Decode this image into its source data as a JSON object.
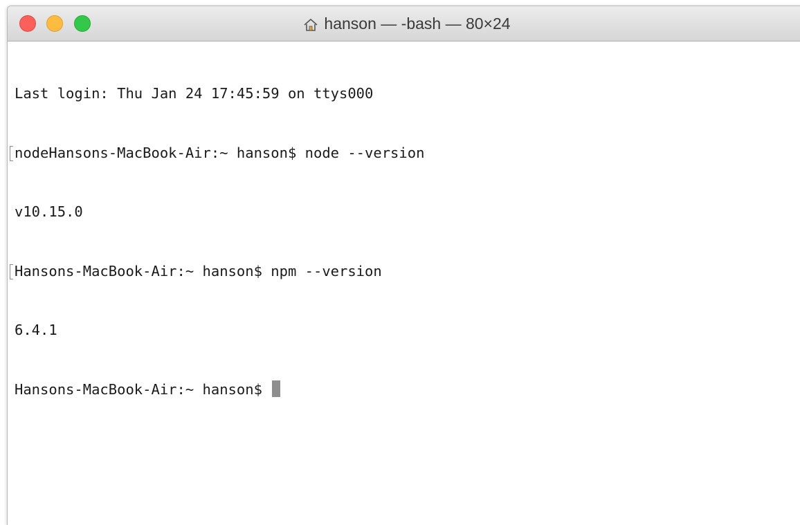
{
  "window": {
    "title": "hanson — -bash — 80×24",
    "title_icon": "home-icon",
    "traffic_lights": {
      "close_color": "#fc605b",
      "minimize_color": "#fdbc40",
      "zoom_color": "#34c84a"
    }
  },
  "terminal": {
    "lines": [
      {
        "text": "Last login: Thu Jan 24 17:45:59 on ttys000",
        "marked": false
      },
      {
        "text": "nodeHansons-MacBook-Air:~ hanson$ node --version",
        "marked": true
      },
      {
        "text": "v10.15.0",
        "marked": false
      },
      {
        "text": "Hansons-MacBook-Air:~ hanson$ npm --version",
        "marked": true
      },
      {
        "text": "6.4.1",
        "marked": false
      }
    ],
    "prompt": "Hansons-MacBook-Air:~ hanson$ "
  }
}
